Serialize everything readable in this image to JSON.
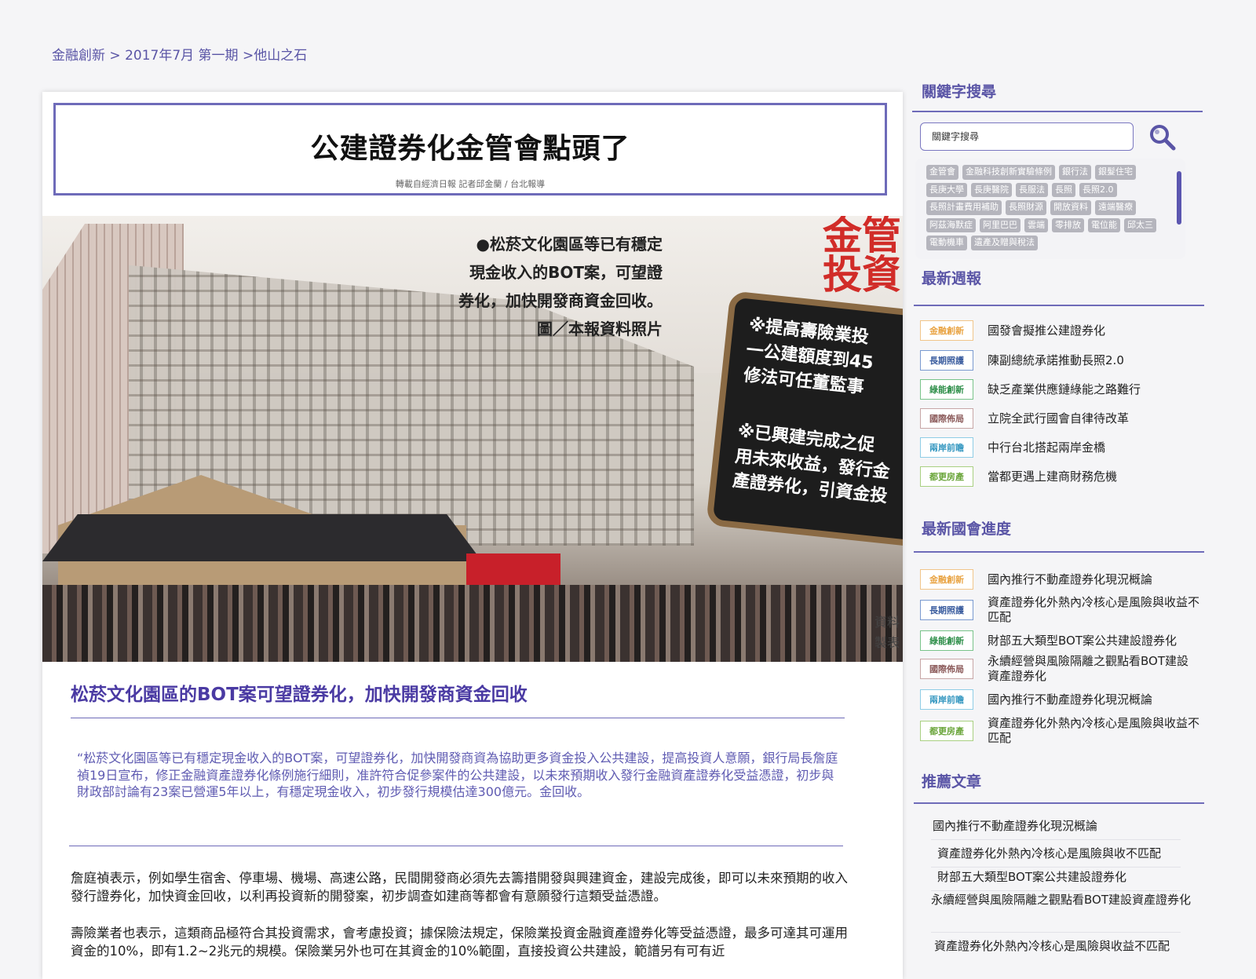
{
  "breadcrumb": {
    "item1": "金融創新",
    "sep1": " > ",
    "item2": "2017年7月 第一期",
    "sep2": " >",
    "item3": "他山之石"
  },
  "article": {
    "title": "公建證券化金管會點頭了",
    "source": "轉載自經濟日報 記者邱金蘭 / 台北報導",
    "photo": {
      "caption_line1": "●松菸文化園區等已有穩定",
      "caption_line2": "現金收入的BOT案，可望證",
      "caption_line3": "券化，加快開發商資金回收。",
      "caption_line4": "圖／本報資料照片",
      "big_red_line1": "金管",
      "big_red_line2": "投資",
      "sign_line1": "※提高壽險業投",
      "sign_line2": "一公建額度到45",
      "sign_line3": "修法可任董監事",
      "sign_line4": "※已興建完成之促",
      "sign_line5": "用未來收益，發行金",
      "sign_line6": "產證券化，引資金投",
      "tag_line1": "資料",
      "tag_line2": "製表"
    },
    "subtitle": "松菸文化園區的BOT案可望證券化，加快開發商資金回收",
    "quote": "“松菸文化園區等已有穩定現金收入的BOT案，可望證券化，加快開發商資為協助更多資金投入公共建設，提高投資人意願，銀行局長詹庭禎19日宣布，修正金融資產證券化條例施行細則，准許符合促參案件的公共建設，以未來預期收入發行金融資產證券化受益憑證，初步與財政部討論有23案已營運5年以上，有穩定現金收入，初步發行規模估達300億元。金回收。",
    "para1": "詹庭禎表示，例如學生宿舍、停車場、機場、高速公路，民間開發商必須先去籌措開發與興建資金，建設完成後，即可以未來預期的收入發行證券化，加快資金回收，以利再投資新的開發案，初步調查如建商等都會有意願發行這類受益憑證。",
    "para2": "壽險業者也表示，這類商品極符合其投資需求，會考慮投資；據保險法規定，保險業投資金融資產證券化等受益憑證，最多可達其可運用資金的10%，即有1.2~2兆元的規模。保險業另外也可在其資金的10%範圍，直接投資公共建設，範譜另有可有近"
  },
  "sidebar": {
    "keyword_heading": "關鍵字搜尋",
    "search_placeholder": "關鍵字搜尋",
    "tags": [
      "金管會",
      "金融科技創新實驗條例",
      "銀行法",
      "銀髮住宅",
      "長庚大學",
      "長庚醫院",
      "長服法",
      "長照",
      "長照2.0",
      "長照計畫費用補助",
      "長照財源",
      "開放資料",
      "遠端醫療",
      "阿茲海默症",
      "阿里巴巴",
      "雲端",
      "零排放",
      "電位能",
      "邱太三",
      "電動機車",
      "遺產及贈與稅法"
    ],
    "weekly_heading": "最新週報",
    "weekly": [
      {
        "badge": "金融創新",
        "text": "國發會擬推公建證券化"
      },
      {
        "badge": "長期照護",
        "text": "陳副總統承諾推動長照2.0"
      },
      {
        "badge": "綠能創新",
        "text": "缺乏產業供應鏈綠能之路難行"
      },
      {
        "badge": "國際佈局",
        "text": "立院全武行國會自律待改革"
      },
      {
        "badge": "兩岸前瞻",
        "text": "中行台北搭起兩岸金橋"
      },
      {
        "badge": "都更房產",
        "text": "當都更遇上建商財務危機"
      }
    ],
    "congress_heading": "最新國會進度",
    "congress": [
      {
        "badge": "金融創新",
        "text": "國內推行不動產證券化現況概論"
      },
      {
        "badge": "長期照護",
        "text": "資產證券化外熱內冷核心是風險與收益不匹配"
      },
      {
        "badge": "綠能創新",
        "text": "財部五大類型BOT案公共建設證券化"
      },
      {
        "badge": "國際佈局",
        "text": "永續經營與風險隔離之觀點看BOT建設資產證券化"
      },
      {
        "badge": "兩岸前瞻",
        "text": "國內推行不動產證券化現況概論"
      },
      {
        "badge": "都更房產",
        "text": "資產證券化外熱內冷核心是風險與收益不匹配"
      }
    ],
    "rec_heading": "推薦文章",
    "recommended": [
      "國內推行不動產證券化現況概論",
      "資產證券化外熱內冷核心是風險與收不匹配",
      "財部五大類型BOT案公共建設證券化",
      "永續經營與風險隔離之觀點看BOT建設資產證券化",
      "資產證券化外熱內冷核心是風險與收益不匹配"
    ]
  },
  "colors": {
    "accent": "#6e6bb9",
    "heading": "#5a55a6",
    "subtitle": "#4a3aa3"
  }
}
